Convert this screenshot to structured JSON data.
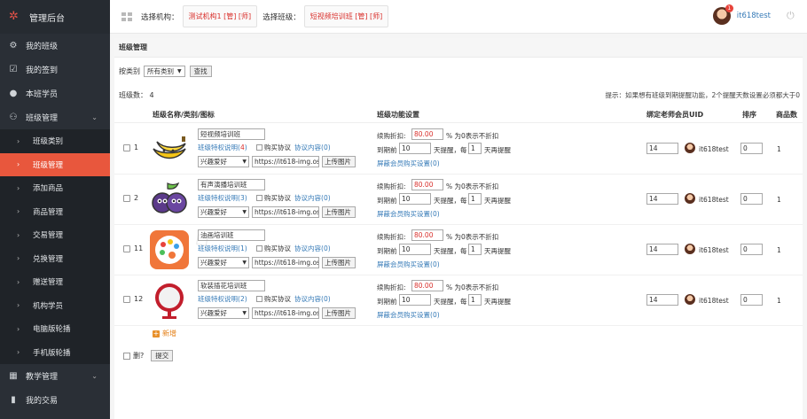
{
  "brand": {
    "title": "管理后台",
    "logo_icon": "gears-icon"
  },
  "sidebar": {
    "items": [
      {
        "label": "我的班级",
        "icon": "gear-icon",
        "type": "top"
      },
      {
        "label": "我的签到",
        "icon": "checkbox-icon",
        "type": "top"
      },
      {
        "label": "本班学员",
        "icon": "user-icon",
        "type": "top"
      },
      {
        "label": "班级管理",
        "icon": "users-icon",
        "type": "top",
        "expanded": true
      },
      {
        "label": "班级类别",
        "type": "sub"
      },
      {
        "label": "班级管理",
        "type": "sub",
        "active": true
      },
      {
        "label": "添加商品",
        "type": "sub"
      },
      {
        "label": "商品管理",
        "type": "sub"
      },
      {
        "label": "交易管理",
        "type": "sub"
      },
      {
        "label": "兑换管理",
        "type": "sub"
      },
      {
        "label": "赠送管理",
        "type": "sub"
      },
      {
        "label": "机构学员",
        "type": "sub"
      },
      {
        "label": "电脑版轮播",
        "type": "sub"
      },
      {
        "label": "手机版轮播",
        "type": "sub"
      },
      {
        "label": "教学管理",
        "icon": "grid-icon",
        "type": "top",
        "expanded": false
      },
      {
        "label": "我的交易",
        "icon": "chart-icon",
        "type": "top"
      }
    ]
  },
  "topbar": {
    "org_label": "选择机构：",
    "org_value": "测试机构1 [管] [师]",
    "class_label": "选择班级：",
    "class_value": "短视频培训班 [管] [师]",
    "username": "it618test",
    "notification_count": "1"
  },
  "panel": {
    "title": "班级管理",
    "filter_label": "按类别",
    "filter_value": "所有类别",
    "search_button": "查找",
    "count_text": "班级数： 4",
    "tip_text": "提示：如果想有班级到期提醒功能，2个提醒天数设置必须都大于0",
    "headers": {
      "name": "班级名称/类别/图标",
      "func": "班级功能设置",
      "teacher": "绑定老师会员UID",
      "sort": "排序",
      "goods": "商品数"
    },
    "labels": {
      "perm": "班级特权说明",
      "buy_protocol": "购买协议",
      "protocol_content": "协议内容",
      "upload": "上传图片",
      "discount_label": "续购折扣:",
      "discount_suffix": "% 为0表示不折扣",
      "expire_label": "到期前",
      "remind_days_label": "天提醒，每",
      "remind_again": "天再提醒",
      "block_buy": "屏蔽会员购买设置"
    },
    "rows": [
      {
        "idx": "1",
        "name": "短视频培训班",
        "perm_count": "4",
        "perm_red": true,
        "protocol_count": "0",
        "category": "兴趣爱好",
        "url": "https://it618-img.oss",
        "discount": "80.00",
        "days": "10",
        "every": "1",
        "block_count": "0",
        "teacher_uid": "14",
        "teacher_name": "it618test",
        "sort": "0",
        "goods": "1",
        "icon": "banana-icon"
      },
      {
        "idx": "2",
        "name": "有声演播培训班",
        "perm_count": "3",
        "perm_red": false,
        "protocol_count": "0",
        "category": "兴趣爱好",
        "url": "https://it618-img.oss",
        "discount": "80.00",
        "days": "10",
        "every": "1",
        "block_count": "0",
        "teacher_uid": "14",
        "teacher_name": "it618test",
        "sort": "0",
        "goods": "1",
        "icon": "blueberry-icon"
      },
      {
        "idx": "11",
        "name": "油画培训班",
        "perm_count": "1",
        "perm_red": false,
        "protocol_count": "0",
        "category": "兴趣爱好",
        "url": "https://it618-img.oss",
        "discount": "80.00",
        "days": "10",
        "every": "1",
        "block_count": "0",
        "teacher_uid": "14",
        "teacher_name": "it618test",
        "sort": "0",
        "goods": "1",
        "icon": "palette-icon"
      },
      {
        "idx": "12",
        "name": "软装插花培训班",
        "perm_count": "2",
        "perm_red": false,
        "protocol_count": "0",
        "category": "兴趣爱好",
        "url": "https://it618-img.oss",
        "discount": "80.00",
        "days": "10",
        "every": "1",
        "block_count": "0",
        "teacher_uid": "14",
        "teacher_name": "it618test",
        "sort": "0",
        "goods": "1",
        "icon": "mirror-icon"
      }
    ],
    "add_label": "新增",
    "delete_label": "删?",
    "submit_button": "提交"
  }
}
